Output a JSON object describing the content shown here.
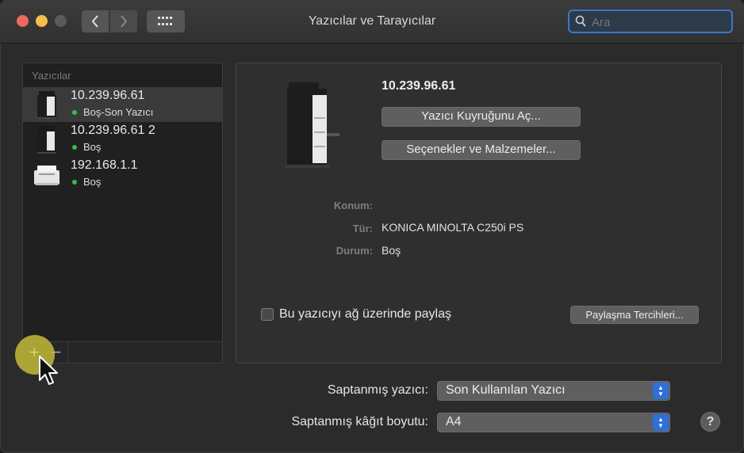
{
  "window": {
    "title": "Yazıcılar ve Tarayıcılar"
  },
  "search": {
    "placeholder": "Ara"
  },
  "sidebar": {
    "header": "Yazıcılar",
    "printers": [
      {
        "name": "10.239.96.61",
        "status": "Boş-Son Yazıcı",
        "icon": "mfp-printer-icon"
      },
      {
        "name": "10.239.96.61 2",
        "status": "Boş",
        "icon": "mfp-printer-icon"
      },
      {
        "name": "192.168.1.1",
        "status": "Boş",
        "icon": "laser-printer-icon"
      }
    ],
    "add_label": "+",
    "remove_label": "−"
  },
  "detail": {
    "printer_name": "10.239.96.61",
    "open_queue_label": "Yazıcı Kuyruğunu Aç...",
    "options_label": "Seçenekler ve Malzemeler...",
    "location_label": "Konum:",
    "location_value": "",
    "kind_label": "Tür:",
    "kind_value": "KONICA MINOLTA C250i PS",
    "status_label": "Durum:",
    "status_value": "Boş",
    "share_label": "Bu yazıcıyı ağ üzerinde paylaş",
    "share_checked": false,
    "sharing_prefs_label": "Paylaşma Tercihleri..."
  },
  "defaults": {
    "default_printer_label": "Saptanmış yazıcı:",
    "default_printer_value": "Son Kullanılan Yazıcı",
    "default_paper_label": "Saptanmış kâğıt boyutu:",
    "default_paper_value": "A4"
  },
  "help_label": "?",
  "colors": {
    "accent": "#2e6fd9",
    "status_idle": "#2fc14b",
    "click_highlight": "#d7cd3c"
  }
}
